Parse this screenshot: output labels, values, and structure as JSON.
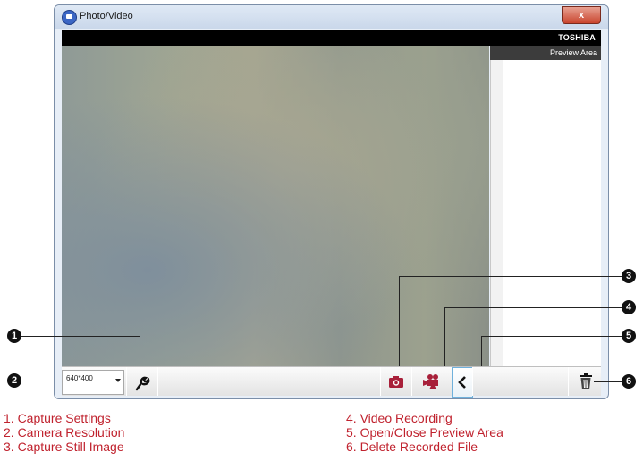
{
  "window": {
    "title": "Photo/Video",
    "close_label": "x",
    "brand": "TOSHIBA"
  },
  "preview": {
    "header": "Preview Area"
  },
  "toolbar": {
    "resolution_value": "640*400"
  },
  "callouts": [
    "1",
    "2",
    "3",
    "4",
    "5",
    "6"
  ],
  "legend": {
    "left": [
      "1. Capture Settings",
      "2. Camera Resolution",
      "3. Capture Still Image"
    ],
    "right": [
      "4. Video Recording",
      "5. Open/Close Preview Area",
      "6. Delete Recorded File"
    ]
  },
  "colors": {
    "accent": "#c0222e",
    "brand_bar": "#000000",
    "preview_header": "#3c3c3c"
  },
  "icons": [
    "camera-app-icon",
    "wrench-icon",
    "camera-icon",
    "video-camera-icon",
    "chevron-left-icon",
    "trash-icon"
  ]
}
